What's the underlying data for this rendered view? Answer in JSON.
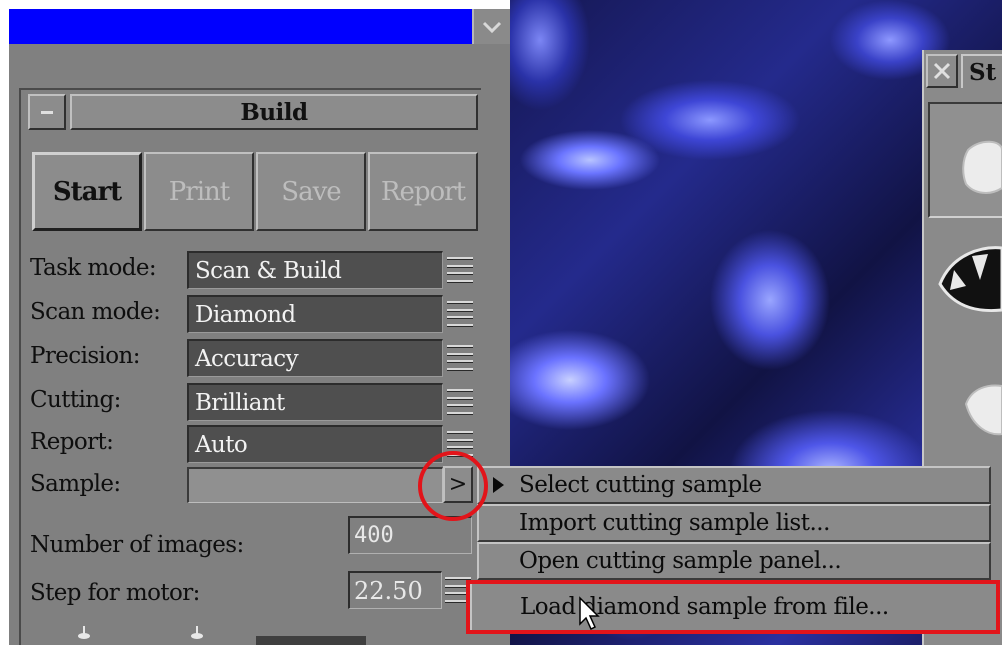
{
  "build_panel": {
    "title": "Build",
    "toolbar": {
      "start": "Start",
      "print": "Print",
      "save": "Save",
      "report": "Report"
    },
    "settings": [
      {
        "label": "Task mode:",
        "value": "Scan & Build"
      },
      {
        "label": "Scan mode:",
        "value": "Diamond"
      },
      {
        "label": "Precision:",
        "value": "Accuracy"
      },
      {
        "label": "Cutting:",
        "value": "Brilliant"
      },
      {
        "label": "Report:",
        "value": "Auto"
      }
    ],
    "sample": {
      "label": "Sample:",
      "value": "",
      "arrow": ">"
    },
    "number_of_images": {
      "label": "Number of images:",
      "value": "400"
    },
    "step_for_motor": {
      "label": "Step for motor:",
      "value": "22.50"
    }
  },
  "side_window": {
    "title": "St"
  },
  "context_menu": {
    "items": [
      {
        "label": "Select cutting sample"
      },
      {
        "label": "Import cutting sample list..."
      },
      {
        "label": "Open cutting sample panel..."
      },
      {
        "label": "Load diamond sample from file..."
      }
    ],
    "highlighted_index": 3
  },
  "icons": {
    "title_chevron": "chevron-down-icon",
    "minimize": "minimize-icon",
    "close": "close-icon",
    "menu_pointer": "submenu-pointer-icon",
    "cursor": "mouse-pointer-icon"
  },
  "colors": {
    "titlebar": "#0000ff",
    "panel": "#808080",
    "field_dark": "#4f4f4f",
    "annotation": "#e2141a"
  }
}
